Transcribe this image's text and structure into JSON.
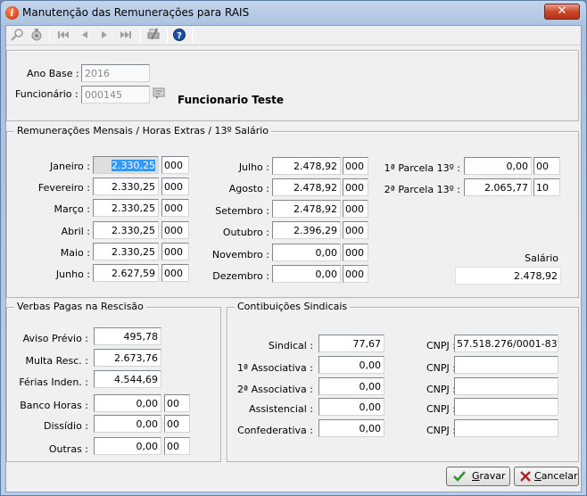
{
  "window": {
    "title": "Manutenção das Remunerações para RAIS",
    "app_icon": "i",
    "close_symbol": "✕"
  },
  "toolbar": {
    "icons": [
      "search-icon",
      "search-record-icon",
      "first-record-icon",
      "previous-record-icon",
      "next-record-icon",
      "last-record-icon",
      "print-icon",
      "help-icon"
    ]
  },
  "header": {
    "ano_base_label": "Ano Base :",
    "ano_base_value": "2016",
    "funcionario_label": "Funcionário :",
    "funcionario_value": "000145",
    "funcionario_name": "Funcionario Teste"
  },
  "remuneracoes": {
    "title": "Remunerações Mensais / Horas Extras / 13º Salário",
    "months_left": [
      {
        "label": "Janeiro :",
        "value": "2.330,25",
        "code": "000"
      },
      {
        "label": "Fevereiro :",
        "value": "2.330,25",
        "code": "000"
      },
      {
        "label": "Março :",
        "value": "2.330,25",
        "code": "000"
      },
      {
        "label": "Abril :",
        "value": "2.330,25",
        "code": "000"
      },
      {
        "label": "Maio :",
        "value": "2.330,25",
        "code": "000"
      },
      {
        "label": "Junho :",
        "value": "2.627,59",
        "code": "000"
      }
    ],
    "months_right": [
      {
        "label": "Julho :",
        "value": "2.478,92",
        "code": "000"
      },
      {
        "label": "Agosto :",
        "value": "2.478,92",
        "code": "000"
      },
      {
        "label": "Setembro :",
        "value": "2.478,92",
        "code": "000"
      },
      {
        "label": "Outubro :",
        "value": "2.396,29",
        "code": "000"
      },
      {
        "label": "Novembro :",
        "value": "0,00",
        "code": "000"
      },
      {
        "label": "Dezembro :",
        "value": "0,00",
        "code": "000"
      }
    ],
    "parcela1": {
      "label": "1ª Parcela 13º :",
      "value": "0,00",
      "code": "00"
    },
    "parcela2": {
      "label": "2ª Parcela 13º :",
      "value": "2.065,77",
      "code": "10"
    },
    "salario_label": "Salário",
    "salario_value": "2.478,92"
  },
  "rescisao": {
    "title": "Verbas Pagas na Rescisão",
    "aviso": {
      "label": "Aviso Prévio :",
      "value": "495,78"
    },
    "multa": {
      "label": "Multa Resc. :",
      "value": "2.673,76"
    },
    "ferias": {
      "label": "Férias Inden. :",
      "value": "4.544,69"
    },
    "banco": {
      "label": "Banco Horas :",
      "value": "0,00",
      "code": "00"
    },
    "dissidio": {
      "label": "Dissídio :",
      "value": "0,00",
      "code": "00"
    },
    "outras": {
      "label": "Outras :",
      "value": "0,00",
      "code": "00"
    }
  },
  "sindicais": {
    "title": "Contibuições Sindicais",
    "rows": [
      {
        "label": "Sindical :",
        "value": "77,67",
        "cnpj_label": "CNPJ :",
        "cnpj": "57.518.276/0001-83"
      },
      {
        "label": "1ª Associativa :",
        "value": "0,00",
        "cnpj_label": "CNPJ :",
        "cnpj": ""
      },
      {
        "label": "2ª Associativa :",
        "value": "0,00",
        "cnpj_label": "CNPJ :",
        "cnpj": ""
      },
      {
        "label": "Assistencial :",
        "value": "0,00",
        "cnpj_label": "CNPJ :",
        "cnpj": ""
      },
      {
        "label": "Confederativa :",
        "value": "0,00",
        "cnpj_label": "CNPJ :",
        "cnpj": ""
      }
    ]
  },
  "buttons": {
    "gravar_pre": "",
    "gravar_ul": "G",
    "gravar_post": "ravar",
    "cancelar_pre": "",
    "cancelar_ul": "C",
    "cancelar_post": "ancelar"
  },
  "colors": {
    "save_check": "#2a9a2a",
    "cancel_x": "#b02020",
    "selection": "#3399ff"
  }
}
